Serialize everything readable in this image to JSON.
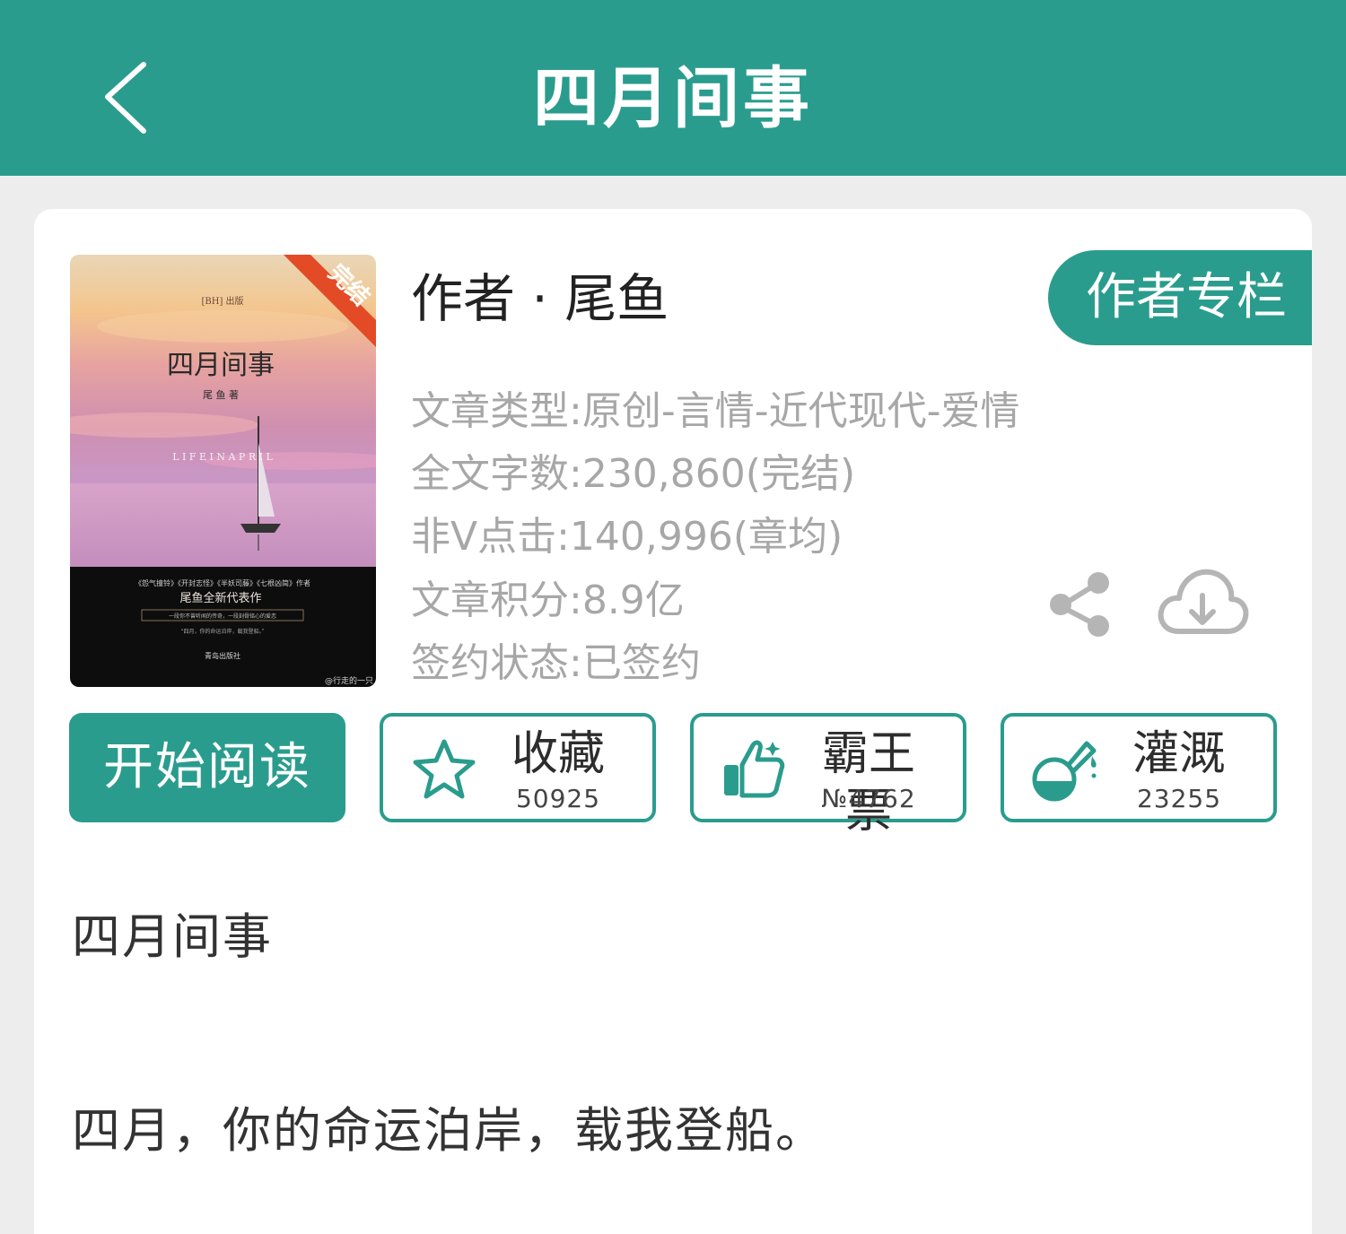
{
  "header": {
    "title": "四月间事",
    "back_icon": "chevron-left-icon"
  },
  "book": {
    "author": "作者 · 尾鱼",
    "author_column_button": "作者专栏",
    "info": [
      "文章类型:原创-言情-近代现代-爱情",
      "全文字数:230,860(完结)",
      "非V点击:140,996(章均)",
      "文章积分:8.9亿",
      "签约状态:已签约"
    ],
    "cover": {
      "ribbon": "完结",
      "publisher_mark": "[BH] 出版",
      "title": "四月间事",
      "author": "尾 鱼 著",
      "subtitle": "L I F E    I N    A P R I L",
      "blurb_line1": "《怨气撞铃》《开封志怪》《半妖司藤》《七根凶简》作者",
      "blurb_line2": "尾鱼全新代表作",
      "blurb_line3": "一段你不曾听闻的传奇，一段刻骨铭心的爱恋",
      "blurb_line4": "“四月，你的命运泊岸，载我登船。”",
      "publisher": "青岛出版社",
      "watermark": "@行走的一只"
    }
  },
  "actions": {
    "read": "开始阅读",
    "collect": {
      "label": "收藏",
      "count": "50925",
      "icon": "star-icon"
    },
    "vote": {
      "label": "霸王票",
      "count": "№4762",
      "icon": "thumbs-up-icon"
    },
    "water": {
      "label": "灌溉",
      "count": "23255",
      "icon": "watering-flask-icon"
    }
  },
  "description": {
    "title": "四月间事",
    "text": "四月，你的命运泊岸，载我登船。"
  },
  "colors": {
    "accent": "#2a9c8d",
    "info_text": "#a7a7a7",
    "background": "#ededed"
  }
}
